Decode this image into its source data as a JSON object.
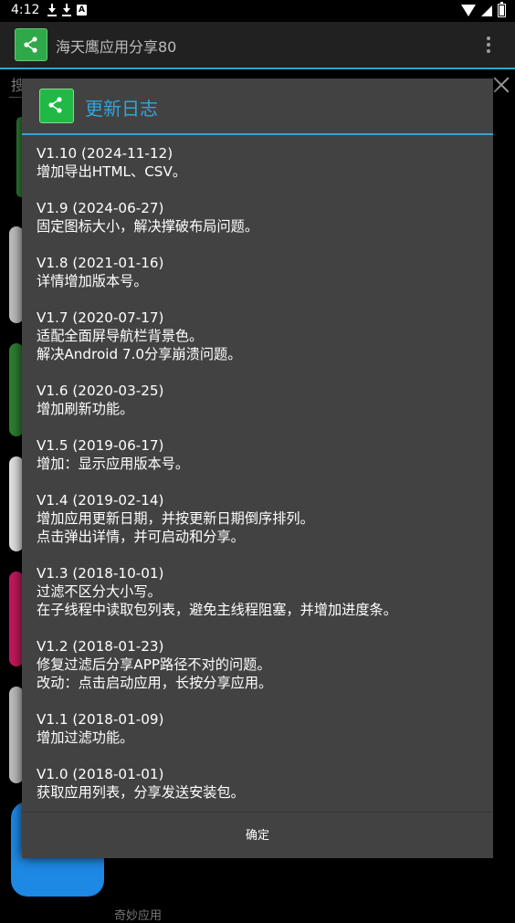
{
  "status_bar": {
    "time": "4:12",
    "badge": "A"
  },
  "app_bar": {
    "title": "海天鹰应用分享80"
  },
  "search": {
    "placeholder": "搜"
  },
  "background_list": {
    "partial_label": "奇妙应用"
  },
  "dialog": {
    "title": "更新日志",
    "ok_label": "确定",
    "entries": [
      {
        "version": "V1.10 (2024-11-12)",
        "lines": [
          "增加导出HTML、CSV。"
        ]
      },
      {
        "version": "V1.9 (2024-06-27)",
        "lines": [
          "固定图标大小，解决撑破布局问题。"
        ]
      },
      {
        "version": "V1.8 (2021-01-16)",
        "lines": [
          "详情增加版本号。"
        ]
      },
      {
        "version": "V1.7 (2020-07-17)",
        "lines": [
          "适配全面屏导航栏背景色。",
          "解决Android 7.0分享崩溃问题。"
        ]
      },
      {
        "version": "V1.6 (2020-03-25)",
        "lines": [
          "增加刷新功能。"
        ]
      },
      {
        "version": "V1.5 (2019-06-17)",
        "lines": [
          "增加：显示应用版本号。"
        ]
      },
      {
        "version": "V1.4 (2019-02-14)",
        "lines": [
          "增加应用更新日期，并按更新日期倒序排列。",
          "点击弹出详情，并可启动和分享。"
        ]
      },
      {
        "version": "V1.3 (2018-10-01)",
        "lines": [
          "过滤不区分大小写。",
          "在子线程中读取包列表，避免主线程阻塞，并增加进度条。"
        ]
      },
      {
        "version": "V1.2 (2018-01-23)",
        "lines": [
          "修复过滤后分享APP路径不对的问题。",
          "改动：点击启动应用，长按分享应用。"
        ]
      },
      {
        "version": "V1.1 (2018-01-09)",
        "lines": [
          "增加过滤功能。"
        ]
      },
      {
        "version": "V1.0 (2018-01-01)",
        "lines": [
          "获取应用列表，分享发送安装包。"
        ]
      }
    ]
  },
  "colors": {
    "accent": "#33a5d6",
    "dialog_bg": "#424242",
    "brand_green": "#21b845"
  },
  "icons": {
    "app_logo": "share-icon",
    "overflow": "more-vert-icon"
  }
}
